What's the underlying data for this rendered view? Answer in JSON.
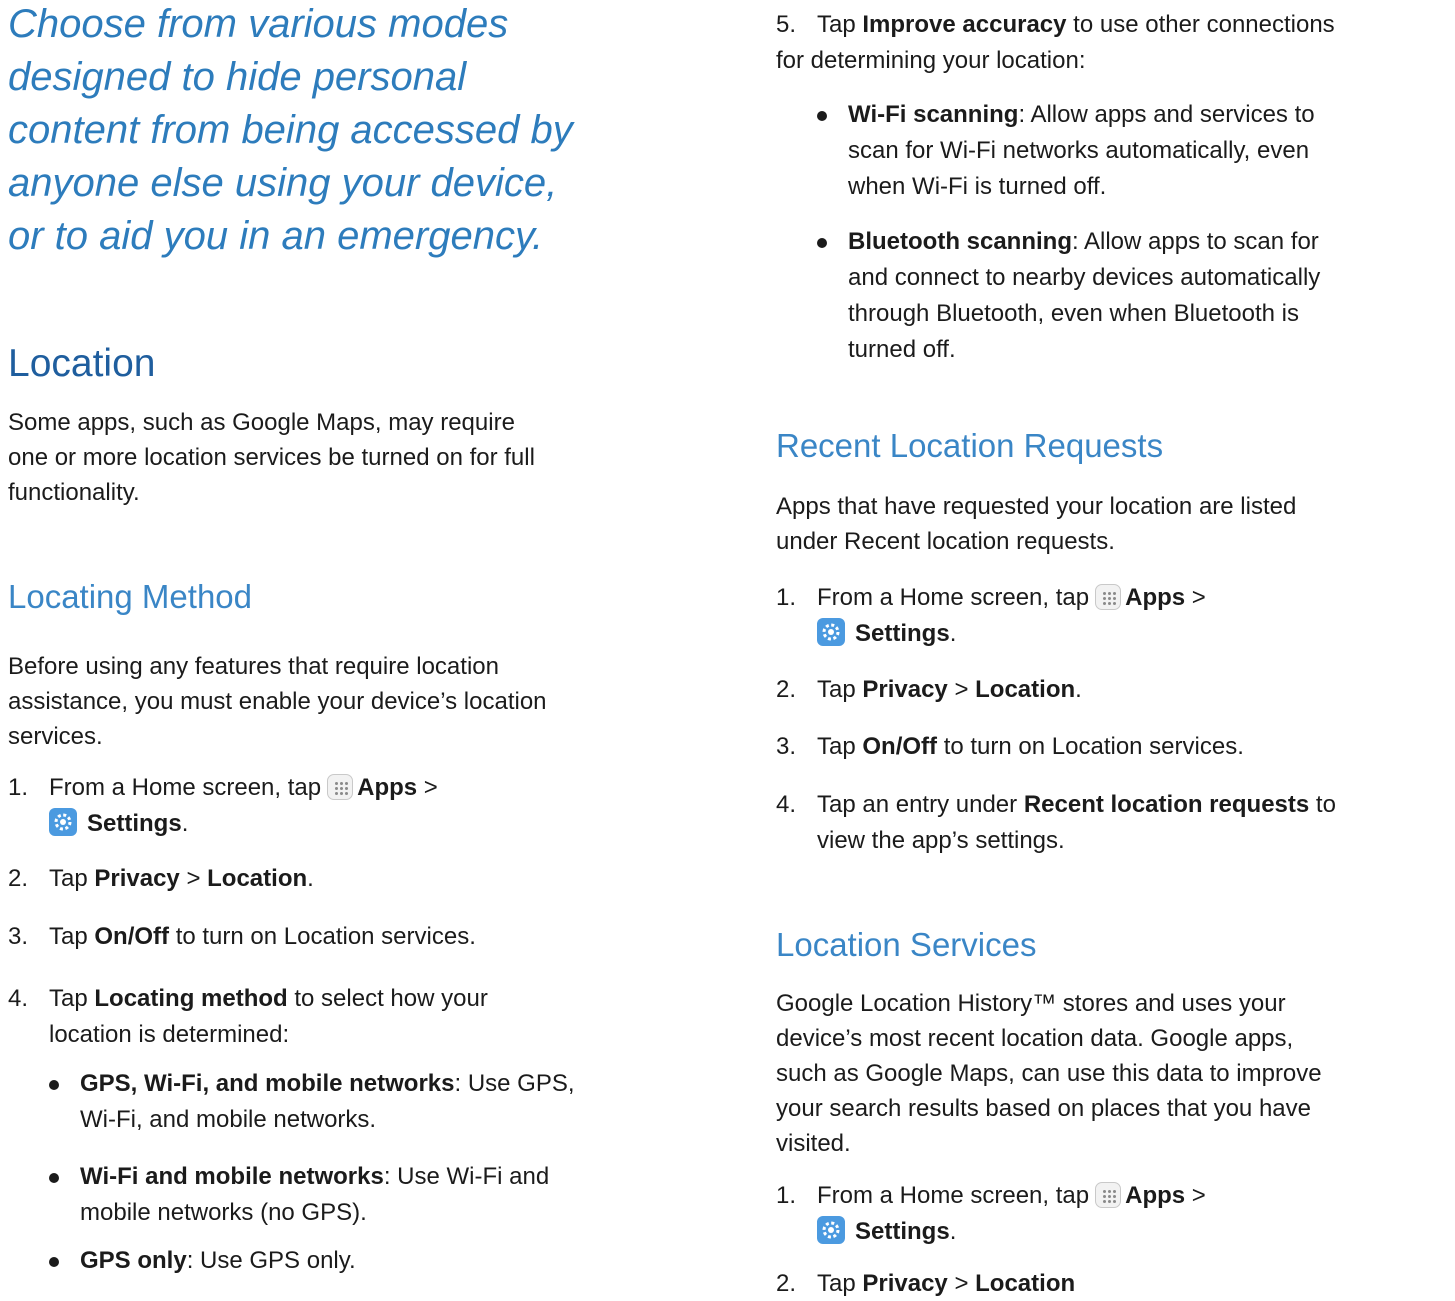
{
  "intro": [
    "Choose from various modes",
    "designed to hide personal",
    "content from being accessed by",
    "anyone else using your device,",
    "or to aid you in an emergency."
  ],
  "location": {
    "title": "Location",
    "description_lines": [
      "Some apps, such as Google Maps, may require",
      "one or more location services be turned on for full",
      "functionality."
    ]
  },
  "locating_method": {
    "title": "Locating Method",
    "description_lines": [
      "Before using any features that require location",
      "assistance, you must enable your device’s location",
      "services."
    ],
    "step1": {
      "num": "1.",
      "pre": "From a Home screen, tap",
      "apps": "Apps",
      "gt": ">",
      "settings": "Settings",
      "end": "."
    },
    "step2": {
      "num": "2.",
      "pre": "Tap",
      "privacy": "Privacy",
      "gt": ">",
      "location": "Location",
      "end": "."
    },
    "step3": {
      "num": "3.",
      "pre": "Tap",
      "onoff": "On/Off",
      "post": "to turn on Location services."
    },
    "step4": {
      "num": "4.",
      "pre": "Tap",
      "bold": "Locating method",
      "post_line1": "to select how your",
      "post_line2": "location is determined:"
    },
    "bullets": [
      {
        "bold": "GPS, Wi-Fi, and mobile networks",
        "line1": ": Use GPS,",
        "line2": "Wi-Fi, and mobile networks."
      },
      {
        "bold": "Wi-Fi and mobile networks",
        "line1": ": Use Wi-Fi and",
        "line2": "mobile networks (no GPS)."
      },
      {
        "bold": "GPS only",
        "line1": ": Use GPS only.",
        "line2": ""
      }
    ]
  },
  "improve": {
    "num": "5.",
    "pre": "Tap",
    "bold": "Improve accuracy",
    "line1": "to use other connections",
    "line2": "for determining your location:",
    "bullets": [
      {
        "bold": "Wi-Fi scanning",
        "lines": [
          ": Allow apps and services to",
          "scan for Wi-Fi networks automatically, even",
          "when Wi-Fi is turned off."
        ]
      },
      {
        "bold": "Bluetooth scanning",
        "lines": [
          ": Allow apps to scan for",
          "and connect to nearby devices automatically",
          "through Bluetooth, even when Bluetooth is",
          "turned off."
        ]
      }
    ]
  },
  "recent": {
    "title": "Recent Location Requests",
    "description_lines": [
      "Apps that have requested your location are listed",
      "under Recent location requests."
    ],
    "step1": {
      "num": "1.",
      "pre": "From a Home screen, tap",
      "apps": "Apps",
      "gt": ">",
      "settings": "Settings",
      "end": "."
    },
    "step2": {
      "num": "2.",
      "pre": "Tap",
      "privacy": "Privacy",
      "gt": ">",
      "location": "Location",
      "end": "."
    },
    "step3": {
      "num": "3.",
      "pre": "Tap",
      "onoff": "On/Off",
      "post": "to turn on Location services."
    },
    "step4": {
      "num": "4.",
      "pre": "Tap an entry under",
      "bold": "Recent location requests",
      "post": "to",
      "line2": "view the app’s settings."
    }
  },
  "services": {
    "title": "Location Services",
    "description_lines": [
      "Google Location History™ stores and uses your",
      "device’s most recent location data. Google apps,",
      "such as Google Maps, can use this data to improve",
      "your search results based on places that you have",
      "visited."
    ],
    "step1": {
      "num": "1.",
      "pre": "From a Home screen, tap",
      "apps": "Apps",
      "gt": ">",
      "settings": "Settings",
      "end": "."
    },
    "step2_partial": {
      "num": "2.",
      "pre": "Tap",
      "privacy": "Privacy",
      "gt": ">",
      "location": "Location"
    }
  },
  "colors": {
    "intro": "#2d7cbc",
    "heading": "#1f5e9e",
    "subheading": "#3a86c6",
    "settings_icon": "#4b9ae0"
  },
  "icons": {
    "apps": "apps-grid-icon",
    "settings": "settings-gear-icon"
  }
}
